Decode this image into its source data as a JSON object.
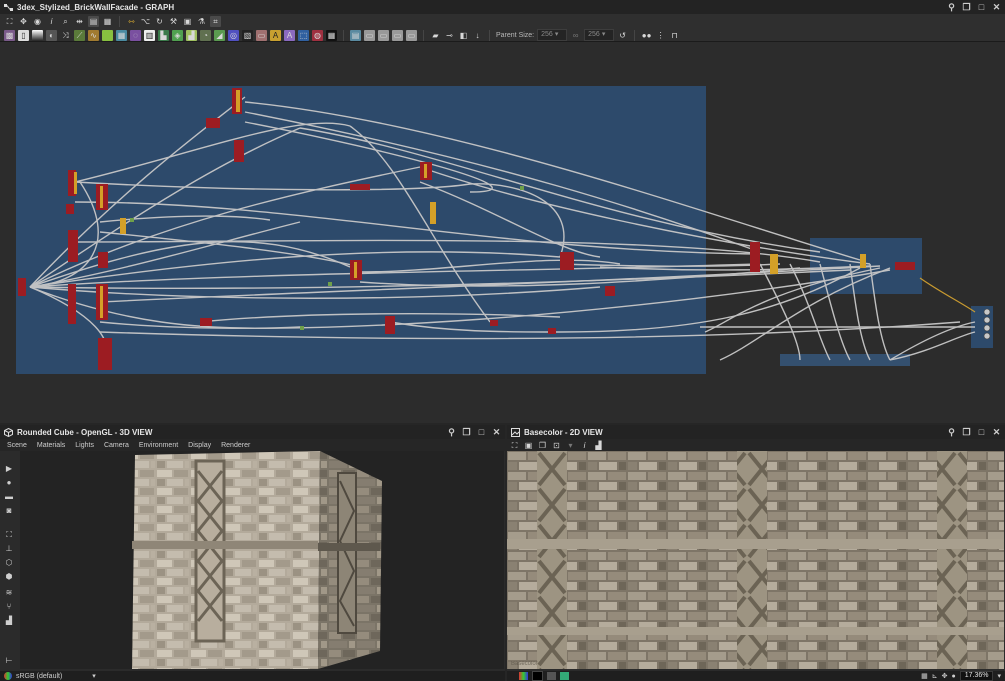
{
  "graph": {
    "title": "3dex_Stylized_BrickWallFacade - GRAPH",
    "parent_size_label": "Parent Size:",
    "parent_size_value": "256",
    "size_value": "256",
    "toolbar_icons": [
      "frame-icon",
      "move-icon",
      "camera-icon",
      "info-icon",
      "search-icon",
      "link-icon",
      "layout-icon",
      "table-icon",
      "arrow-icon",
      "branch-icon",
      "rotate-icon",
      "tool-icon",
      "screen-icon",
      "flask-icon",
      "frame-select-icon"
    ],
    "node_icons": [
      "image-icon",
      "page-icon",
      "gradient-icon",
      "shuffle-icon",
      "pen-icon",
      "blend-icon",
      "curve-icon",
      "green-icon",
      "grid-icon",
      "blur-icon",
      "hsl-icon",
      "levels-icon",
      "blend-b-icon",
      "gradient-map-icon",
      "warp-icon",
      "circle-icon",
      "pattern-icon",
      "mask-icon",
      "brightness-icon",
      "text-icon",
      "transform-icon",
      "color-icon",
      "fx-icon",
      "selected-icon"
    ],
    "colors": {
      "frame": "#2d4a6b",
      "wire": "#c9c9c9",
      "node_red": "#9c1c22",
      "node_yellow": "#c8a028",
      "node_green": "#6fa04a"
    }
  },
  "view3d": {
    "title": "Rounded Cube - OpenGL - 3D VIEW",
    "menu": [
      "Scene",
      "Materials",
      "Lights",
      "Camera",
      "Environment",
      "Display",
      "Renderer"
    ],
    "status": "sRGB (default)"
  },
  "view2d": {
    "title": "Basecolor - 2D VIEW",
    "zoom": "17.36%",
    "watermark": "Basecolor"
  }
}
